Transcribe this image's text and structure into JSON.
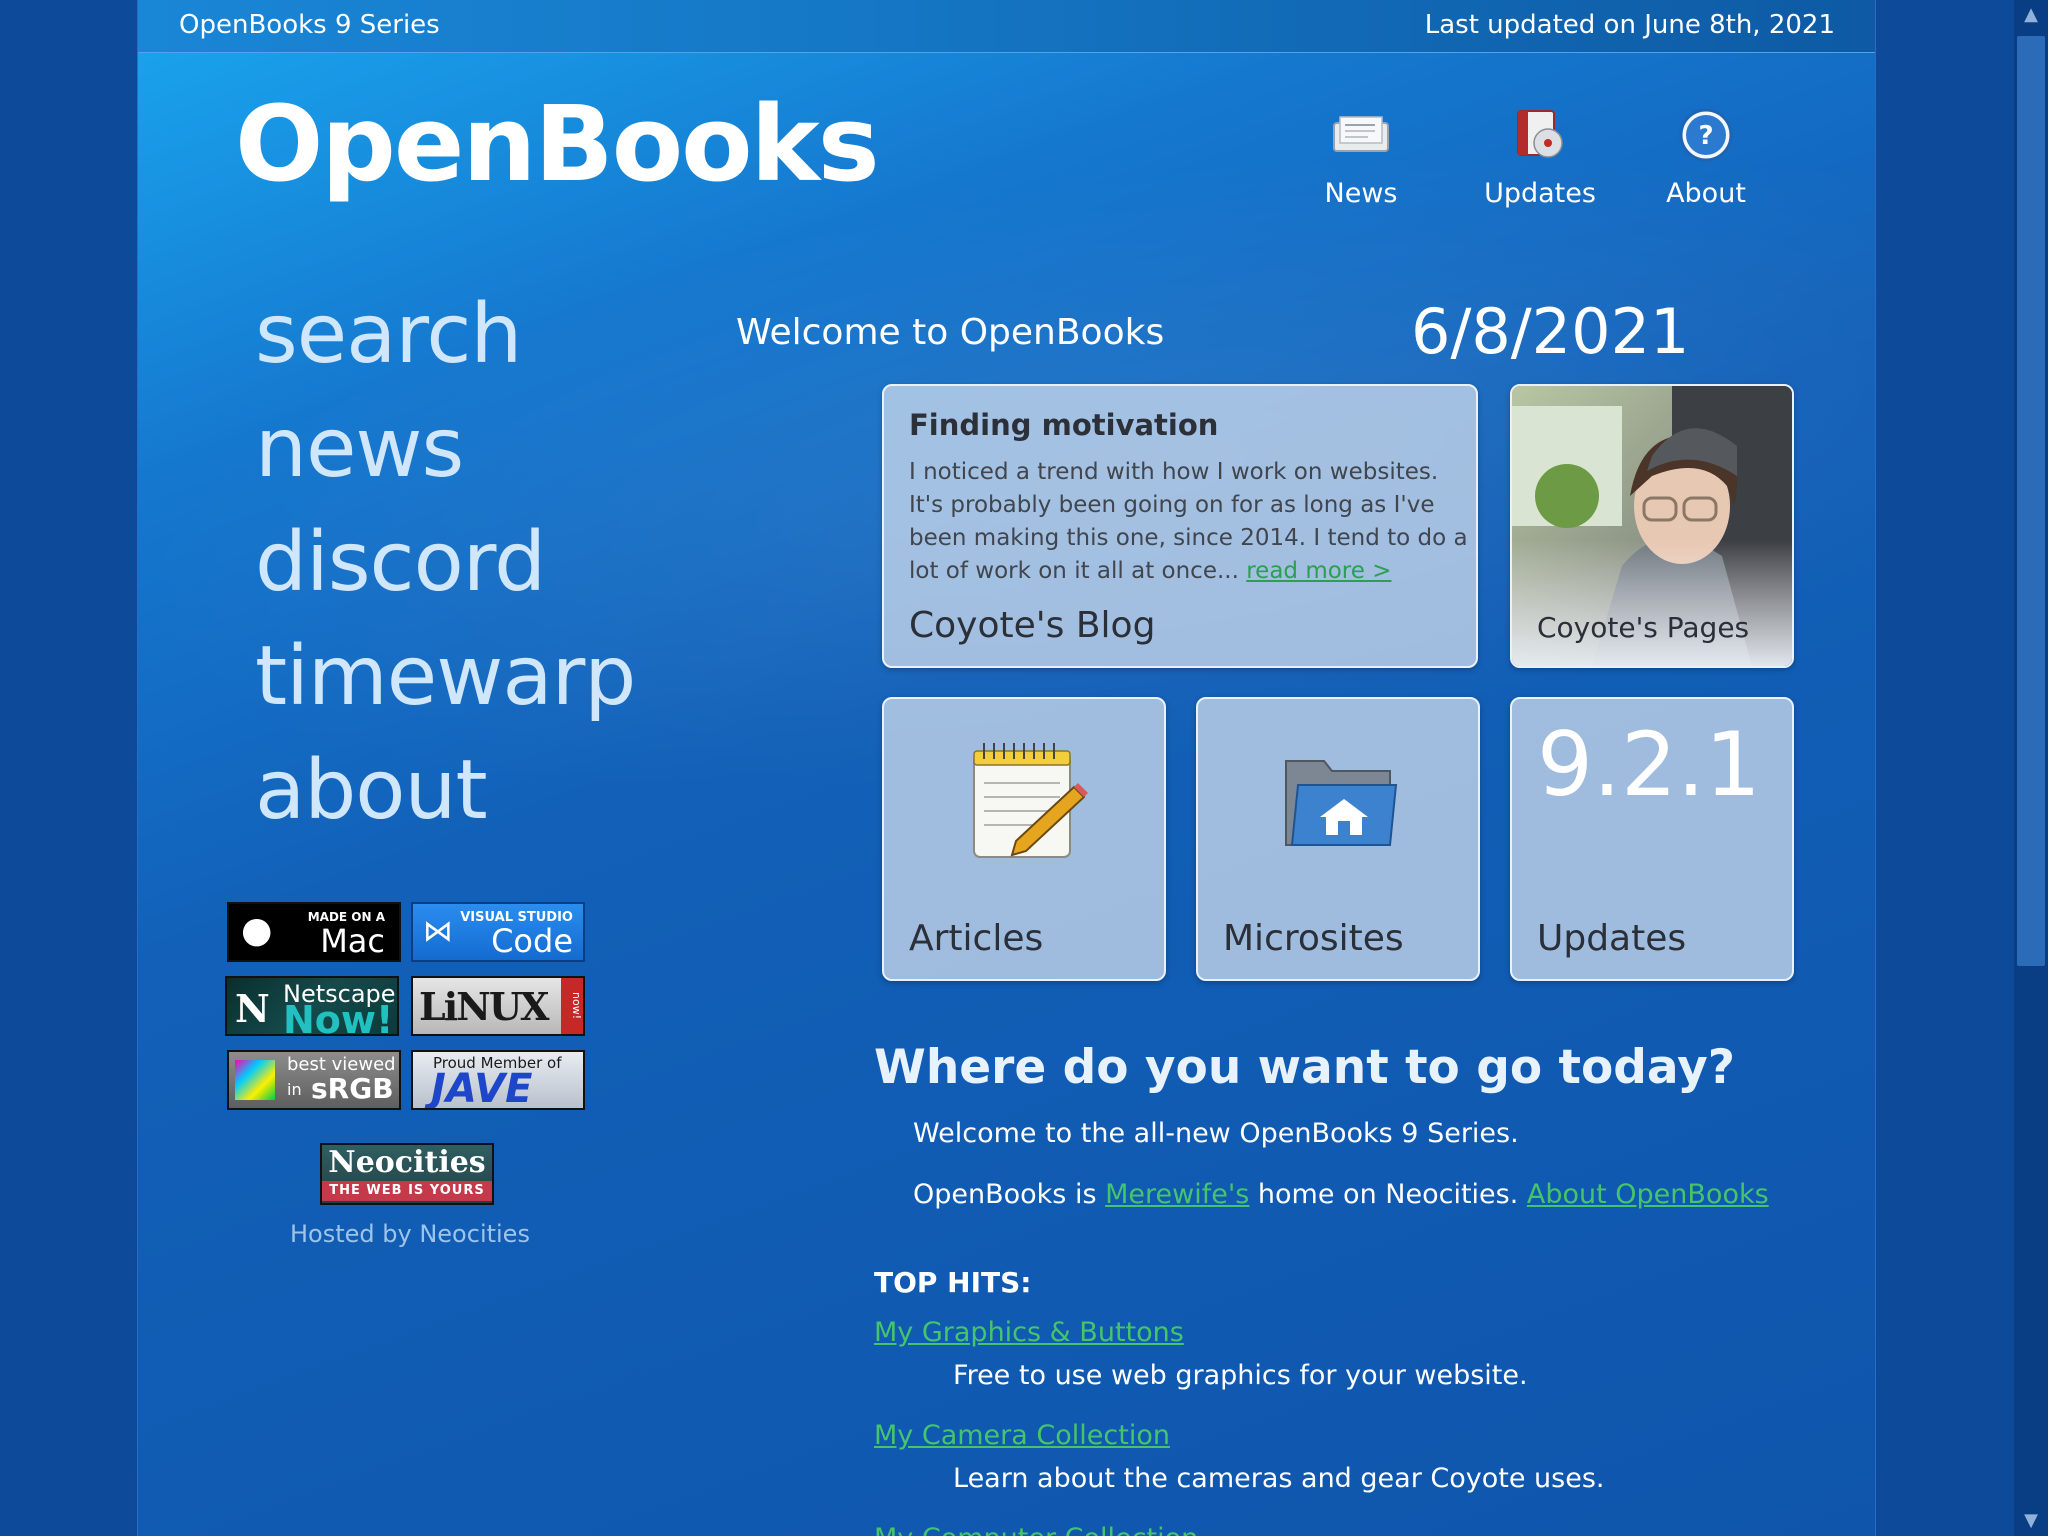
{
  "topbar": {
    "series": "OpenBooks 9 Series",
    "updated": "Last updated on June 8th, 2021"
  },
  "logo": "OpenBooks",
  "topnav": [
    {
      "label": "News",
      "icon": "newspaper-icon"
    },
    {
      "label": "Updates",
      "icon": "install-disc-icon"
    },
    {
      "label": "About",
      "icon": "help-circle-icon"
    }
  ],
  "sidenav": [
    "search",
    "news",
    "discord",
    "timewarp",
    "about"
  ],
  "badges": {
    "mac": {
      "small": "MADE ON A",
      "big": "Mac"
    },
    "vscode": {
      "small": "VISUAL STUDIO",
      "big": "Code"
    },
    "netscape": {
      "small": "Netscape",
      "big": "Now!"
    },
    "linux": {
      "big": "LiNUX",
      "side": "now!"
    },
    "srgb": {
      "small": "best viewed",
      "big": "sRGB",
      "in": "in"
    },
    "jave": {
      "small": "Proud Member of",
      "big": "JAVE"
    }
  },
  "neocities": {
    "title": "Neocities",
    "tagline": "THE WEB IS YOURS"
  },
  "hosted": "Hosted by Neocities",
  "main": {
    "welcome": "Welcome to OpenBooks",
    "date": "6/8/2021",
    "blog": {
      "title": "Finding motivation",
      "body": "I noticed a trend with how I work on websites. It's probably been going on for as long as I've been making this one, since 2014. I tend to do a lot of work on it all at once...",
      "read_more": "read more >",
      "label": "Coyote's Blog"
    },
    "pages_label": "Coyote's Pages",
    "articles_label": "Articles",
    "microsites_label": "Microsites",
    "updates": {
      "version": "9.2.1",
      "label": "Updates"
    },
    "where": "Where do you want to go today?",
    "intro1": "Welcome to the all-new OpenBooks 9 Series.",
    "intro2": {
      "pre": "OpenBooks is ",
      "link1": "Merewife's",
      "mid": " home on Neocities. ",
      "link2": "About OpenBooks"
    },
    "top_hits_title": "TOP HITS:",
    "hits": [
      {
        "title": "My Graphics & Buttons",
        "desc": "Free to use web graphics for your website."
      },
      {
        "title": "My Camera Collection",
        "desc": "Learn about the cameras and gear Coyote uses."
      },
      {
        "title": "My Computer Collection"
      }
    ]
  }
}
